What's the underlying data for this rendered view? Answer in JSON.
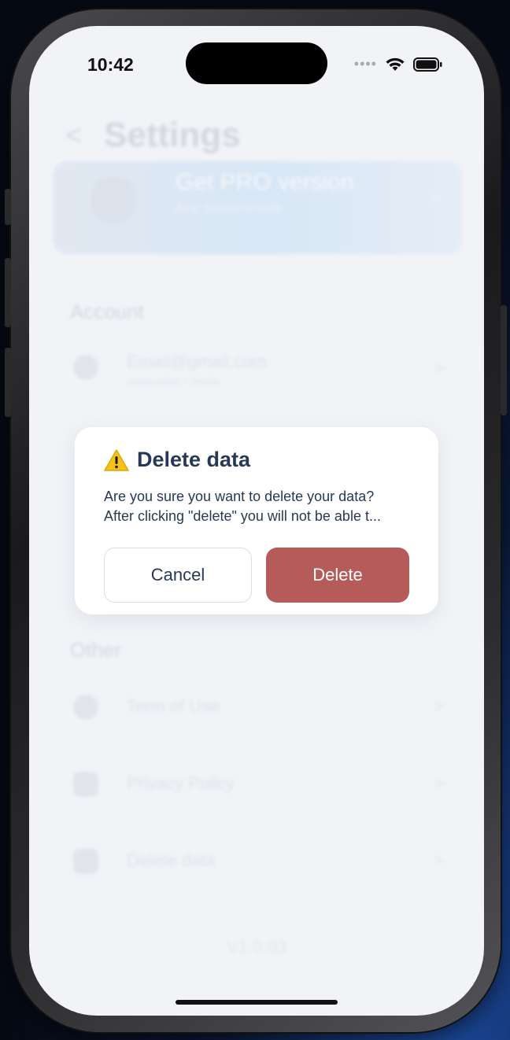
{
  "status_bar": {
    "time": "10:42",
    "signal_dots": "••••"
  },
  "background": {
    "back_glyph": "<",
    "title": "Settings",
    "pro_card": {
      "title": "Get PRO version",
      "subtitle": "Any Semanticsalit",
      "chevron": ">"
    },
    "sections": {
      "account": {
        "label": "Account"
      },
      "other": {
        "label": "Other"
      }
    },
    "account_rows": [
      {
        "label": "Email@gmail.com",
        "sub": "subscription ▪ details",
        "icon": "person-icon"
      }
    ],
    "other_rows": [
      {
        "label": "Term of Use",
        "icon": "cc-icon"
      },
      {
        "label": "Privacy Policy",
        "icon": "document-icon"
      },
      {
        "label": "Delete data",
        "icon": "trash-icon"
      }
    ],
    "version": "V1.0.03"
  },
  "dialog": {
    "icon": "warning-icon",
    "title": "Delete data",
    "message_line1": "Are you sure you want to delete your data?",
    "message_line2": "After clicking \"delete\" you will not be able t...",
    "cancel_label": "Cancel",
    "delete_label": "Delete",
    "colors": {
      "delete_button": "#b55c5a",
      "title_text": "#263a55"
    }
  }
}
